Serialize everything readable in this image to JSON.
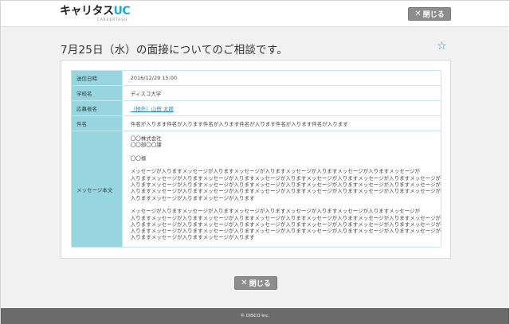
{
  "header": {
    "logo_text": "キャリタス",
    "logo_accent": "UC",
    "logo_sub": "CAREERTASU",
    "close_label": "閉じる"
  },
  "title": "7月25日（水）の面接についてのご相談です。",
  "rows": {
    "sent": {
      "label": "送信日時",
      "value": "2016/12/29 15:00"
    },
    "school": {
      "label": "学校名",
      "value": "ディスコ大学"
    },
    "applicant": {
      "label": "応募者名",
      "value": "（他外）山田 太郎"
    },
    "subject": {
      "label": "件名",
      "value": "件名が入ります件名が入ります件名が入ります件名が入ります件名が入ります件名が入ります"
    },
    "body": {
      "label": "メッセージ本文",
      "company": "〇〇株式会社",
      "dept": "〇〇部〇〇課",
      "recipient": "〇〇様",
      "p1": [
        "メッセージが入りますメッセージが入りますメッセージが入りますメッセージが入りますメッセージが入りますメッセージが",
        "入りますメッセージが入りますメッセージが入りますメッセージが入りますメッセージが入りますメッセージが入りますメッセージが",
        "入りますメッセージが入りますメッセージが入りますメッセージが入りますメッセージが入りますメッセージが入りますメッセージが",
        "入りますメッセージが入りますメッセージが入りますメッセージが入りますメッセージが入りますメッセージが入りますメッセージが",
        "入りますメッセージが入りますメッセージが入ります"
      ],
      "p2": [
        "メッセージが入りますメッセージが入りますメッセージが入りますメッセージが入りますメッセージが入りますメッセージが",
        "入りますメッセージが入りますメッセージが入りますメッセージが入りますメッセージが入りますメッセージが入りますメッセージが",
        "入りますメッセージが入りますメッセージが入りますメッセージが入りますメッセージが入りますメッセージが入りますメッセージが",
        "入りますメッセージが入りますメッセージが入りますメッセージが入りますメッセージが入りますメッセージが入りますメッセージが",
        "入りますメッセージが入りますメッセージが入ります"
      ]
    }
  },
  "footer": {
    "copyright": "© DISCO Inc."
  },
  "icons": {
    "close": "close-icon",
    "star": "star-outline-icon"
  },
  "colors": {
    "accent": "#2aa6c8",
    "header_cell": "#97d6de",
    "button": "#8d8d8d",
    "footer": "#6b6b6b"
  }
}
